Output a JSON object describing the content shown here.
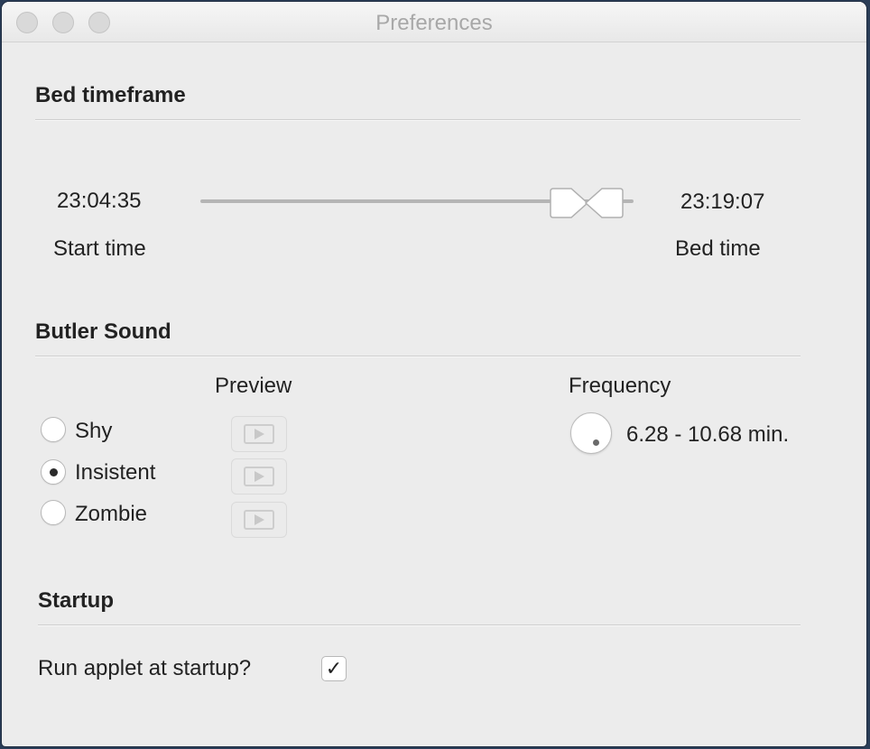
{
  "window": {
    "title": "Preferences"
  },
  "bed_timeframe": {
    "title": "Bed timeframe",
    "start_time_value": "23:04:35",
    "start_time_label": "Start time",
    "bed_time_value": "23:19:07",
    "bed_time_label": "Bed time"
  },
  "butler_sound": {
    "title": "Butler Sound",
    "preview_label": "Preview",
    "options": [
      {
        "label": "Shy",
        "selected": false
      },
      {
        "label": "Insistent",
        "selected": true
      },
      {
        "label": "Zombie",
        "selected": false
      }
    ],
    "frequency_label": "Frequency",
    "frequency_value": "6.28 - 10.68 min."
  },
  "startup": {
    "title": "Startup",
    "run_at_startup_label": "Run applet at startup?",
    "run_at_startup_checked": true,
    "check_glyph": "✓"
  },
  "icons": {
    "play": "play-icon",
    "slider_knob": "slider-knob-icon"
  }
}
